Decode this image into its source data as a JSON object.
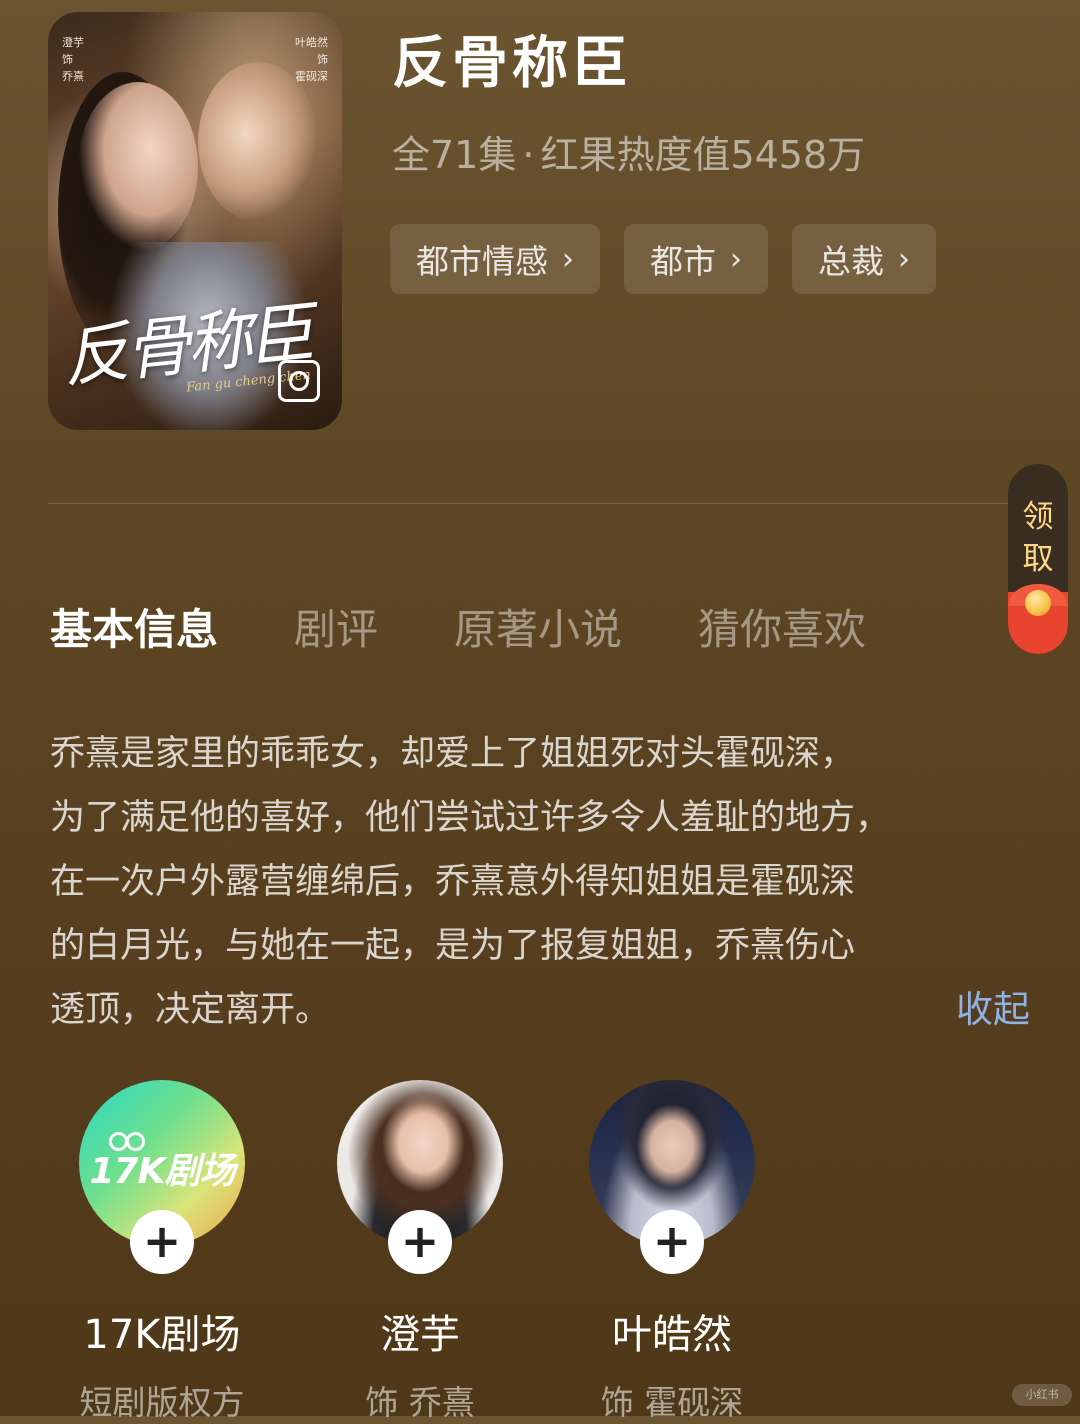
{
  "drama": {
    "title": "反骨称臣",
    "episodes": "全71集",
    "separator": "·",
    "heat": "红果热度值5458万",
    "tags": [
      {
        "label": "都市情感"
      },
      {
        "label": "都市"
      },
      {
        "label": "总裁"
      }
    ]
  },
  "poster": {
    "credits_left": "澄芋\n饰\n乔熹",
    "credits_right": "叶皓然\n饰\n霍砚深",
    "title": "反骨称臣",
    "subtitle": "Fan gu cheng chen"
  },
  "side_widget": {
    "label": "领\n取"
  },
  "tabs": [
    {
      "label": "基本信息",
      "active": true
    },
    {
      "label": "剧评",
      "active": false
    },
    {
      "label": "原著小说",
      "active": false
    },
    {
      "label": "猜你喜欢",
      "active": false
    }
  ],
  "description": {
    "lines": [
      "乔熹是家里的乖乖女，却爱上了姐姐死对头霍砚深，",
      "为了满足他的喜好，他们尝试过许多令人羞耻的地方，",
      "在一次户外露营缠绵后，乔熹意外得知姐姐是霍砚深",
      "的白月光，与她在一起，是为了报复姐姐，乔熹伤心",
      "透顶，决定离开。"
    ],
    "collapse_label": "收起"
  },
  "people": [
    {
      "name": "17K剧场",
      "role": "短剧版权方",
      "avatar_text": "17K剧场",
      "follow": "+"
    },
    {
      "name": "澄芋",
      "role": "饰 乔熹",
      "follow": "+"
    },
    {
      "name": "叶皓然",
      "role": "饰 霍砚深",
      "follow": "+"
    }
  ],
  "watermark": "小红书",
  "colors": {
    "background": "#5e4724",
    "collapse_link": "#8fb3e6",
    "claim_text": "#ffd884",
    "envelope": "#e8432e"
  }
}
